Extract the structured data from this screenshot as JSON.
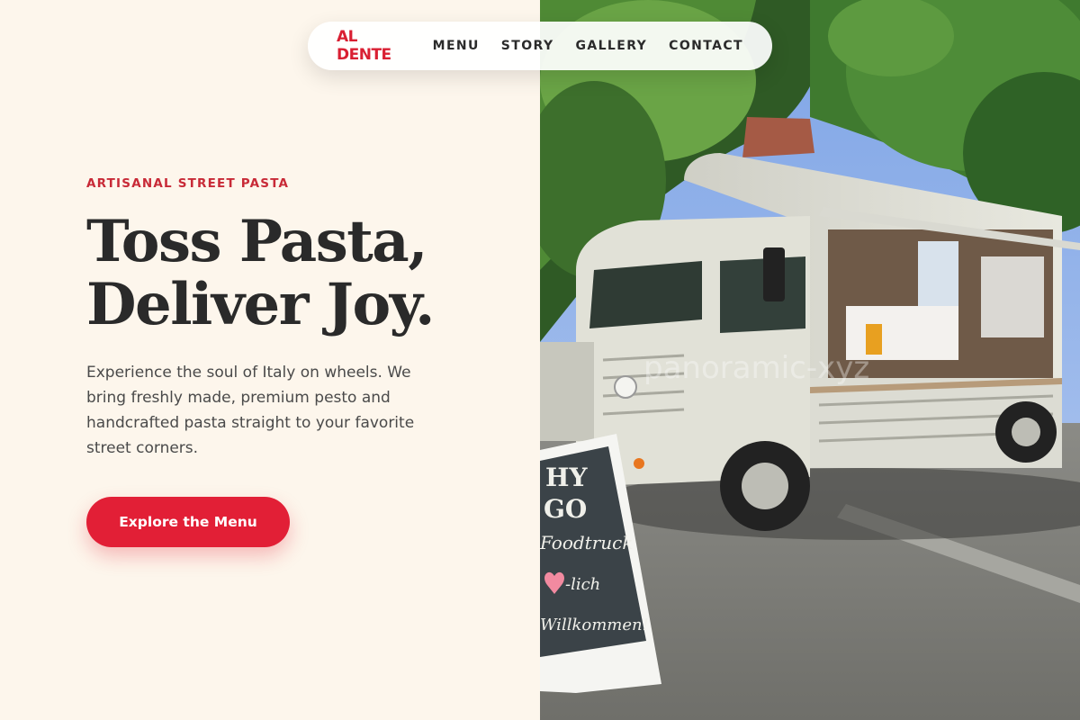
{
  "nav": {
    "brand": "AL DENTE",
    "links": [
      "MENU",
      "STORY",
      "GALLERY",
      "CONTACT"
    ]
  },
  "hero": {
    "eyebrow": "ARTISANAL STREET PASTA",
    "headline_line1": "Toss Pasta,",
    "headline_line2": "Deliver Joy.",
    "description": "Experience the soul of Italy on wheels. We bring freshly made, premium pesto and handcrafted pasta straight to your favorite street corners.",
    "cta_label": "Explore the Menu"
  },
  "photo": {
    "sign_lines": [
      "HY",
      "GO",
      "Foodtruck",
      "-lich",
      "Willkommen!"
    ],
    "watermark": "panoramic-xyz"
  },
  "colors": {
    "accent": "#e21f36",
    "background": "#fdf6ec",
    "text_dark": "#2a2a2a"
  }
}
